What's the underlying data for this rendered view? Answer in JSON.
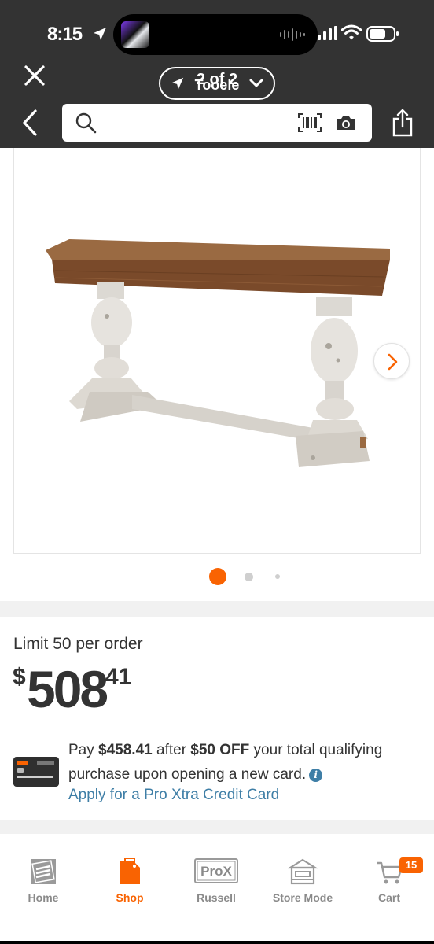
{
  "status_bar": {
    "time": "8:15",
    "icons": [
      "location-arrow-icon",
      "cellular-signal-icon",
      "wifi-icon",
      "battery-icon"
    ],
    "dynamic_island": {
      "thumbnail": "now-playing-artwork",
      "activity": "audio-waveform-icon"
    }
  },
  "header": {
    "close_icon": "close-icon",
    "location_pill": {
      "counter": "2 of 2",
      "store": "Tooele",
      "icons": [
        "location-arrow-icon",
        "chevron-down-icon"
      ]
    },
    "back_icon": "chevron-left-icon",
    "search": {
      "value": "",
      "placeholder": ""
    },
    "search_icons": [
      "search-icon",
      "barcode-scan-icon",
      "camera-icon"
    ],
    "share_icon": "share-icon"
  },
  "gallery": {
    "image": "console-table-product-photo",
    "next_icon": "chevron-right-icon",
    "total_slides": 3,
    "active_slide": 1
  },
  "pricing": {
    "limit": "Limit 50 per order",
    "currency": "$",
    "dollars": "508",
    "cents": "41"
  },
  "credit_offer": {
    "pay_prefix": "Pay ",
    "pay_amount": "$458.41",
    "after": " after ",
    "discount": "$50 OFF",
    "rest": " your total qualifying purchase upon opening a new card.",
    "info_icon": "info-icon",
    "link": "Apply for a Pro Xtra Credit Card"
  },
  "bottom_nav": {
    "items": [
      {
        "label": "Home",
        "icon": "home-depot-logo-icon",
        "active": false
      },
      {
        "label": "Shop",
        "icon": "shop-tag-icon",
        "active": true
      },
      {
        "label": "Russell",
        "icon": "pro-xtra-icon",
        "icon_text": "ProX",
        "active": false
      },
      {
        "label": "Store Mode",
        "icon": "storefront-icon",
        "active": false
      },
      {
        "label": "Cart",
        "icon": "cart-icon",
        "active": false
      }
    ],
    "cart_count": "15"
  },
  "colors": {
    "brand_orange": "#f96302",
    "header_bg": "#333333",
    "link_blue": "#3e7ea6",
    "text": "#333333",
    "muted": "#8a8a8a"
  }
}
